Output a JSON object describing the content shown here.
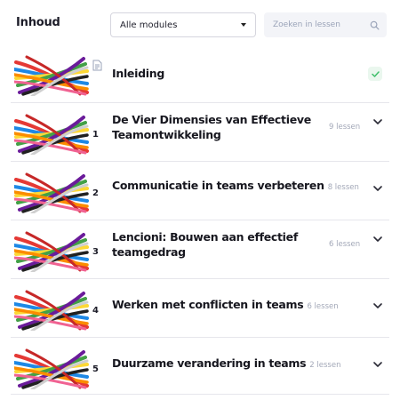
{
  "header": {
    "title": "Inhoud",
    "module_select": {
      "value": "Alle modules"
    },
    "search": {
      "placeholder": "Zoeken in lessen"
    }
  },
  "modules": [
    {
      "number": "",
      "title": "Inleiding",
      "count": "",
      "status": "completed"
    },
    {
      "number": "1",
      "title": "De Vier Dimensies van Effectieve Teamontwikkeling",
      "count": "9 lessen"
    },
    {
      "number": "2",
      "title": "Communicatie in teams verbeteren",
      "count": "8 lessen"
    },
    {
      "number": "3",
      "title": "Lencioni: Bouwen aan effectief teamgedrag",
      "count": "6 lessen"
    },
    {
      "number": "4",
      "title": "Werken met conflicten in teams",
      "count": "6 lessen"
    },
    {
      "number": "5",
      "title": "Duurzame verandering in teams",
      "count": "2 lessen"
    }
  ],
  "icons": {
    "doc": "document-icon",
    "chevron": "chevron-down-icon",
    "check": "check-icon",
    "search": "search-icon",
    "caret": "caret-down-icon"
  },
  "colors": {
    "check_green": "#3fbf6a",
    "check_bg": "#eaf7ee",
    "muted": "#a3a8b8"
  }
}
